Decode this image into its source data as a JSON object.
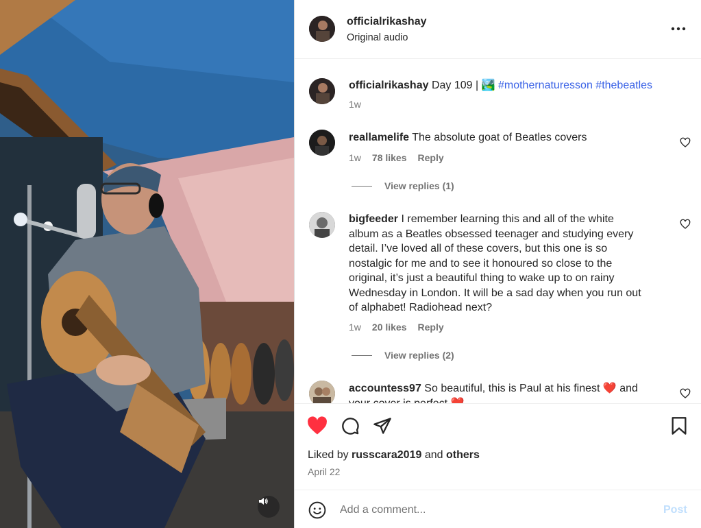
{
  "post": {
    "username": "officialrikashay",
    "audio": "Original audio",
    "caption_user": "officialrikashay",
    "caption_text": "Day 109 |",
    "caption_emoji": "🏞️",
    "caption_tags": "#mothernaturesson #thebeatles",
    "caption_time": "1w"
  },
  "comments": [
    {
      "user": "reallamelife",
      "text": "The absolute goat of Beatles covers",
      "time": "1w",
      "likes": "78 likes",
      "reply": "Reply",
      "view_replies": "View replies (1)"
    },
    {
      "user": "bigfeeder",
      "text_lines": [
        "I remember learning this and all of the white",
        "album as a Beatles obsessed teenager and studying every",
        "detail. I’ve loved all of these covers, but this one is so",
        "nostalgic for me and to see it honoured so close to the",
        "original, it’s just a beautiful thing to wake up to on rainy",
        "Wednesday in London. It will be a sad day when you run out",
        "of alphabet! Radiohead next?"
      ],
      "time": "1w",
      "likes": "20 likes",
      "reply": "Reply",
      "view_replies": "View replies (2)"
    },
    {
      "user": "accountess97",
      "text": "So beautiful, this is Paul at his finest ❤️ and",
      "text2": "your cover is perfect ❤️"
    }
  ],
  "likes_summary": {
    "prefix": "Liked by",
    "user": "russcara2019",
    "mid": "and",
    "others": "others"
  },
  "date": "April 22",
  "composer": {
    "placeholder": "Add a comment...",
    "post_label": "Post"
  },
  "icons": {
    "more": "more-options-icon",
    "like": "heart-filled-icon",
    "comment": "comment-icon",
    "share": "share-icon",
    "save": "bookmark-icon",
    "emoji": "emoji-icon",
    "audio": "speaker-icon"
  },
  "colors": {
    "like_red": "#ff3040",
    "hashtag_blue": "#3a62e6",
    "muted_text": "#737373",
    "post_disabled": "#c0dffd"
  }
}
